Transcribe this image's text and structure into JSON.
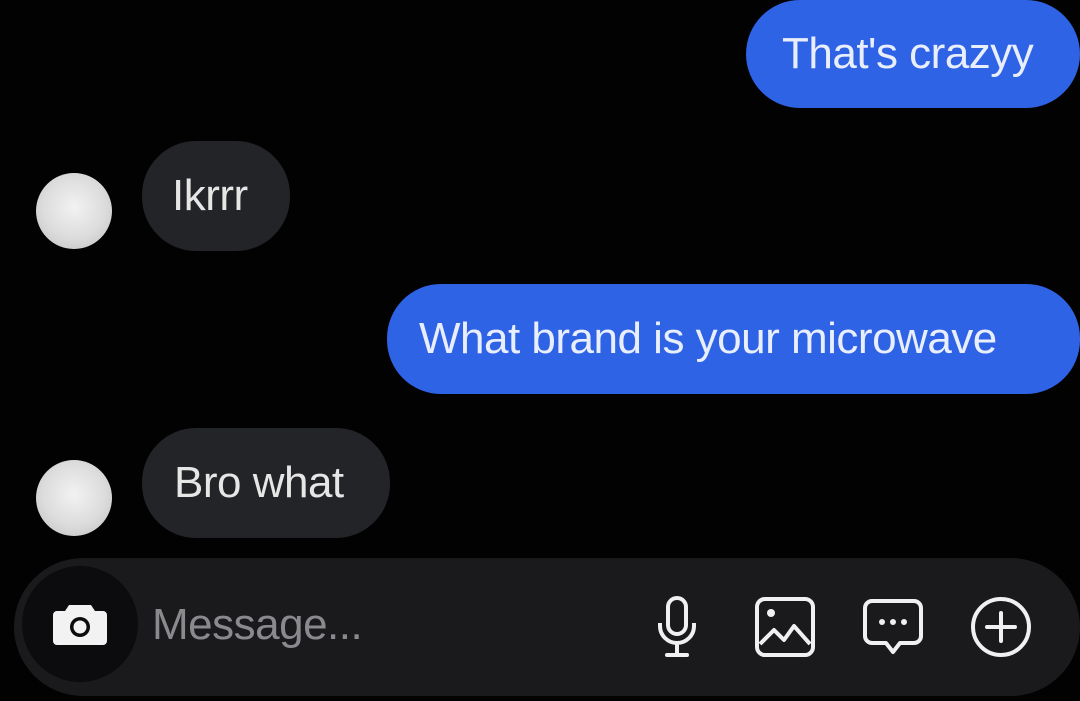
{
  "messages": [
    {
      "direction": "outgoing",
      "text": "That's crazyy"
    },
    {
      "direction": "incoming",
      "text": "Ikrrr"
    },
    {
      "direction": "outgoing",
      "text": "What brand is your microwave"
    },
    {
      "direction": "incoming",
      "text": "Bro what"
    }
  ],
  "composer": {
    "placeholder": "Message...",
    "icons": [
      "camera-icon",
      "microphone-icon",
      "image-icon",
      "sticker-icon",
      "plus-icon"
    ]
  },
  "colors": {
    "outgoing_bubble": "#2f63e6",
    "incoming_bubble": "#232427",
    "background": "#020203"
  }
}
